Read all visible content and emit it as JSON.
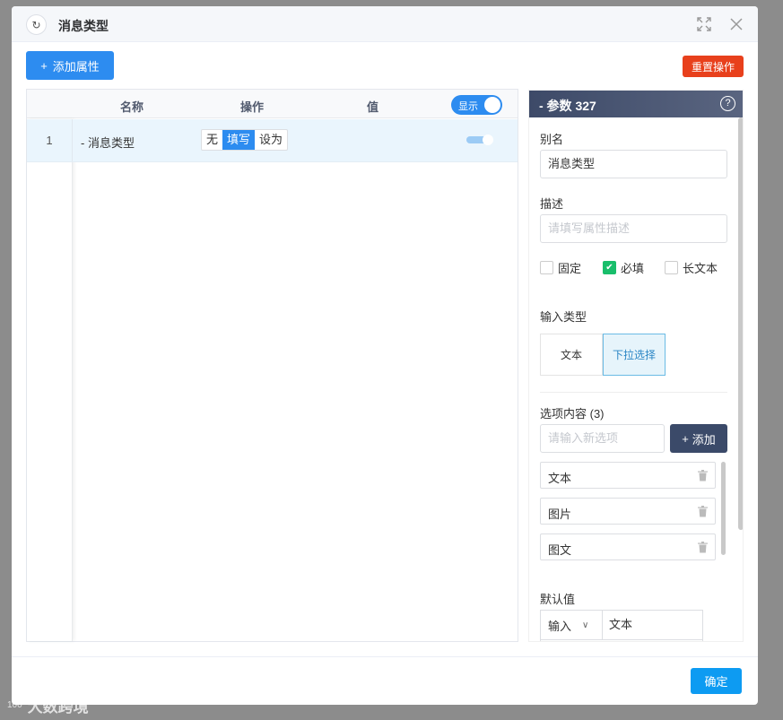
{
  "dialog": {
    "title": "消息类型",
    "refresh_icon": "refresh-icon",
    "fullscreen_icon": "fullscreen-icon",
    "close_icon": "close-icon"
  },
  "toolbar": {
    "add_attr_label": "添加属性",
    "reset_label": "重置操作"
  },
  "table": {
    "headers": {
      "name": "名称",
      "action": "操作",
      "value": "值"
    },
    "show_toggle_label": "显示",
    "show_toggle_on": true,
    "rows": [
      {
        "index": "1",
        "name": "- 消息类型",
        "ops": [
          "无",
          "填写",
          "设为"
        ],
        "active_op": "填写"
      }
    ]
  },
  "panel": {
    "title": "- 参数 327",
    "alias_label": "别名",
    "alias_value": "消息类型",
    "desc_label": "描述",
    "desc_placeholder": "请填写属性描述",
    "checkboxes": [
      {
        "label": "固定",
        "checked": false
      },
      {
        "label": "必填",
        "checked": true
      },
      {
        "label": "长文本",
        "checked": false
      }
    ],
    "input_type_label": "输入类型",
    "input_types": [
      {
        "label": "文本",
        "active": false
      },
      {
        "label": "下拉选择",
        "active": true
      }
    ],
    "options_label": "选项内容 (3)",
    "new_option_placeholder": "请输入新选项",
    "add_option_label": "添加",
    "options": [
      "文本",
      "图片",
      "图文"
    ],
    "default_label": "默认值",
    "default_mode": "输入",
    "default_value": "文本"
  },
  "footer": {
    "ok_label": "确定"
  },
  "watermark": {
    "logo_text": "100",
    "text": "大数跨境"
  },
  "colors": {
    "primary": "#2d8cf0",
    "danger": "#e8401c",
    "success": "#19be6b",
    "panel_head": "#3d4a68",
    "ok": "#0d9bf2"
  }
}
